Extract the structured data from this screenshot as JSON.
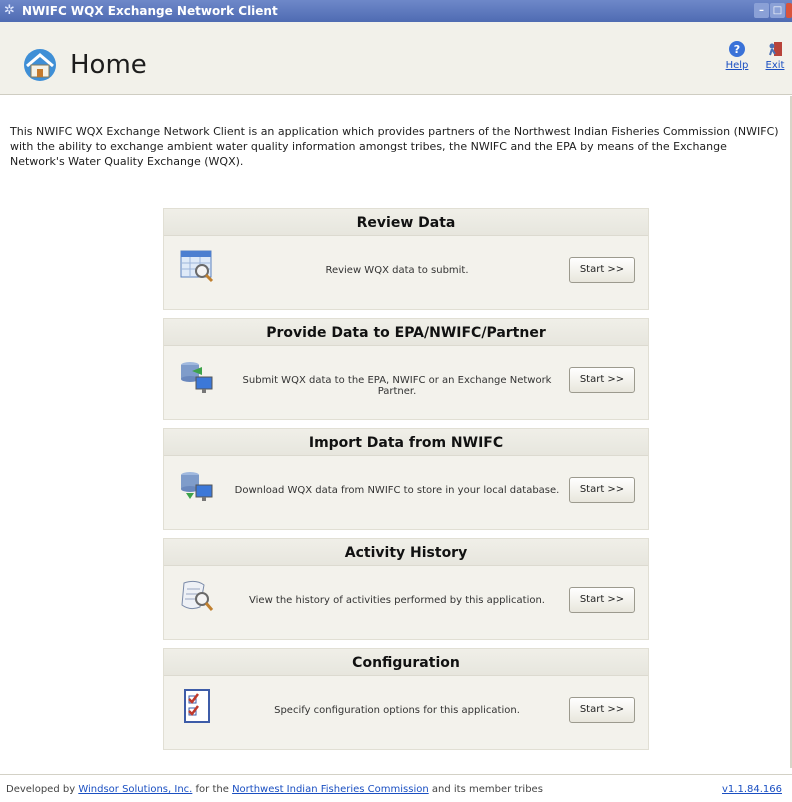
{
  "window": {
    "title": "NWIFC WQX Exchange Network Client"
  },
  "header": {
    "page_title": "Home",
    "help_label": "Help",
    "exit_label": "Exit"
  },
  "intro": "This NWIFC WQX Exchange Network Client is an application which provides partners of the Northwest Indian Fisheries Commission (NWIFC) with the ability to exchange ambient water quality information amongst tribes, the NWIFC and the EPA by means of the Exchange Network's Water Quality Exchange (WQX).",
  "cards": [
    {
      "title": "Review Data",
      "description": "Review WQX data to submit.",
      "button": "Start >>",
      "icon": "review-data-icon"
    },
    {
      "title": "Provide Data to EPA/NWIFC/Partner",
      "description": "Submit WQX data to the EPA, NWIFC or an Exchange Network Partner.",
      "button": "Start >>",
      "icon": "submit-data-icon"
    },
    {
      "title": "Import Data from NWIFC",
      "description": "Download WQX data from NWIFC to store in your local database.",
      "button": "Start >>",
      "icon": "import-data-icon"
    },
    {
      "title": "Activity History",
      "description": "View the history of activities performed by this application.",
      "button": "Start >>",
      "icon": "activity-history-icon"
    },
    {
      "title": "Configuration",
      "description": "Specify configuration options for this application.",
      "button": "Start >>",
      "icon": "configuration-icon"
    }
  ],
  "footer": {
    "developed_by": "Developed by",
    "developer_link": "Windsor Solutions, Inc.",
    "for_the": "for the",
    "org_link": "Northwest Indian Fisheries Commission",
    "and_members": "and its member tribes",
    "version": "v1.1.84.166"
  }
}
